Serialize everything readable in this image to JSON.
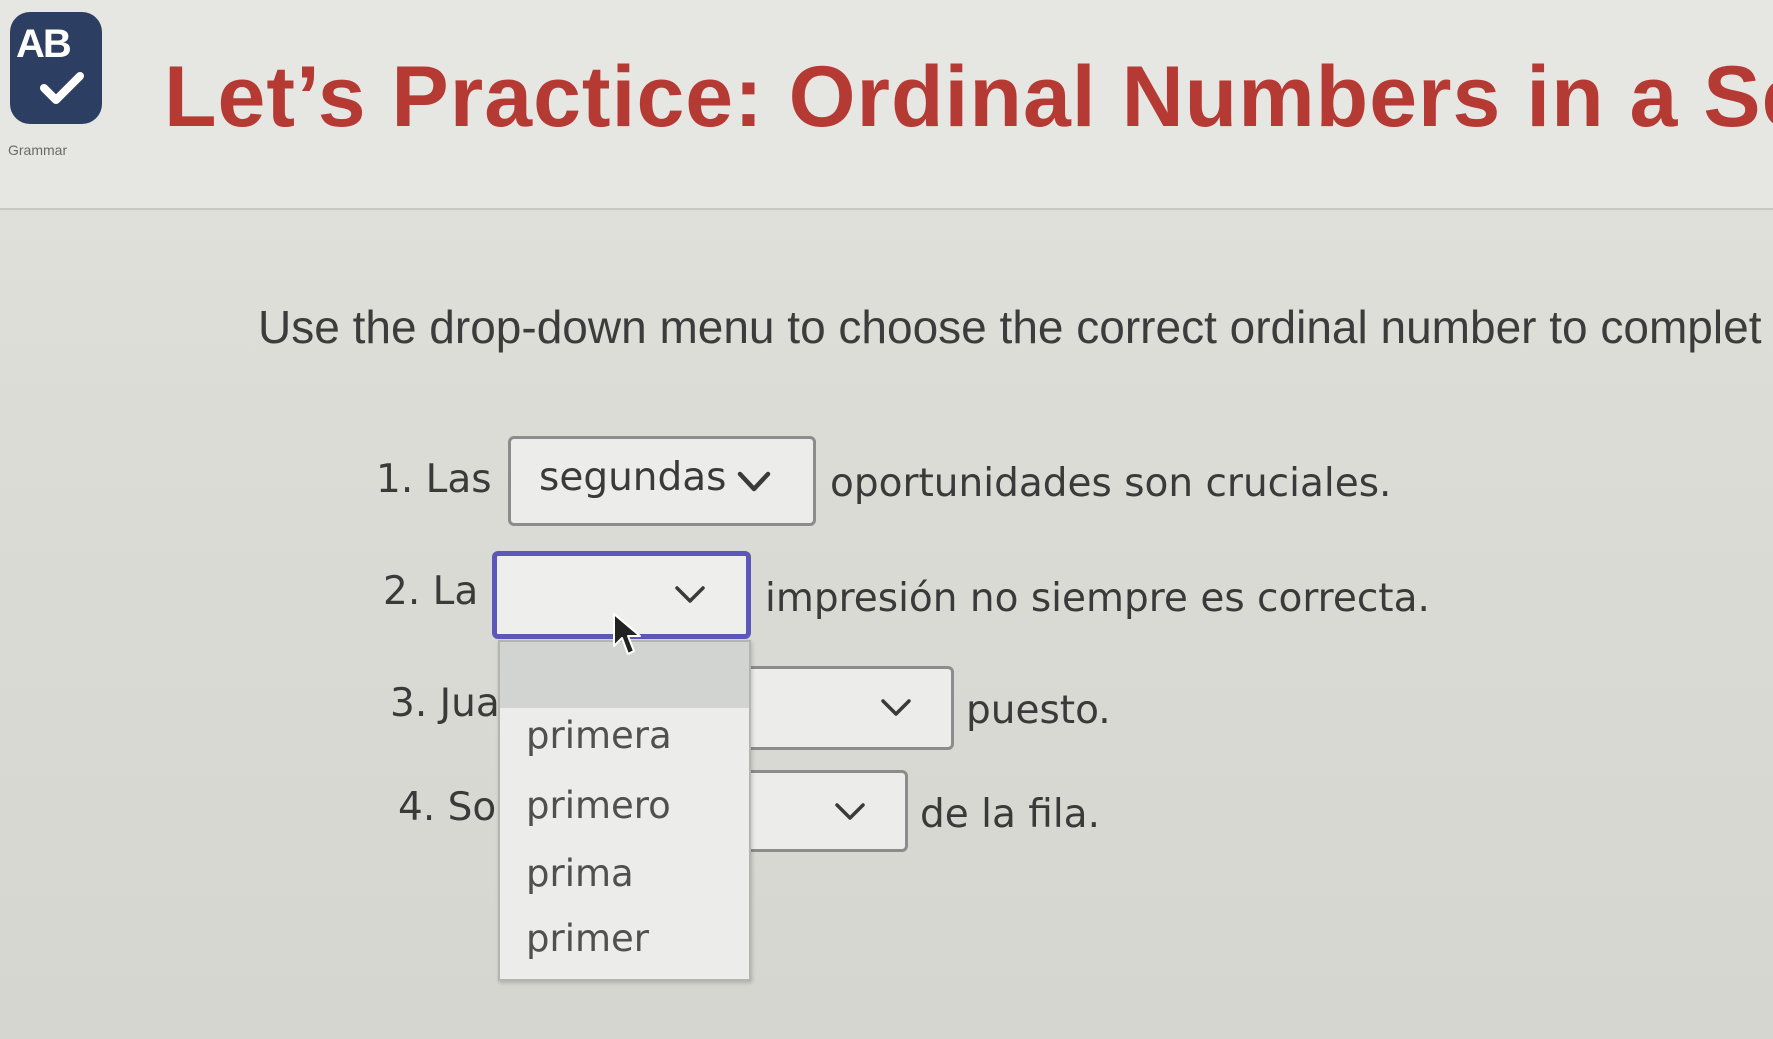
{
  "header": {
    "logo_text": "AB",
    "logo_caption": "Grammar",
    "title": "Let’s Practice: Ordinal Numbers in a Sen"
  },
  "instructions": "Use the drop-down menu to choose the correct ordinal number to complet",
  "questions": [
    {
      "prefix": "1. Las",
      "selected": "segundas",
      "suffix": "oportunidades son cruciales."
    },
    {
      "prefix": "2. La",
      "selected": "",
      "suffix": "impresión no siempre es correcta."
    },
    {
      "prefix": "3. Jua",
      "selected": "",
      "suffix": "puesto."
    },
    {
      "prefix": "4. So",
      "selected": "",
      "suffix": "de la fila."
    }
  ],
  "dropdown": {
    "open_for_question": 2,
    "options": [
      "",
      "primera",
      "primero",
      "prima",
      "primer"
    ]
  },
  "colors": {
    "title": "#b63a34",
    "logo_bg": "#2d3e63",
    "active_border": "#5c57b8",
    "background": "#dcdcd6"
  },
  "icons": {
    "chevron": "chevron-down-icon",
    "cursor": "mouse-pointer-icon",
    "logo_check": "checkmark-icon"
  }
}
